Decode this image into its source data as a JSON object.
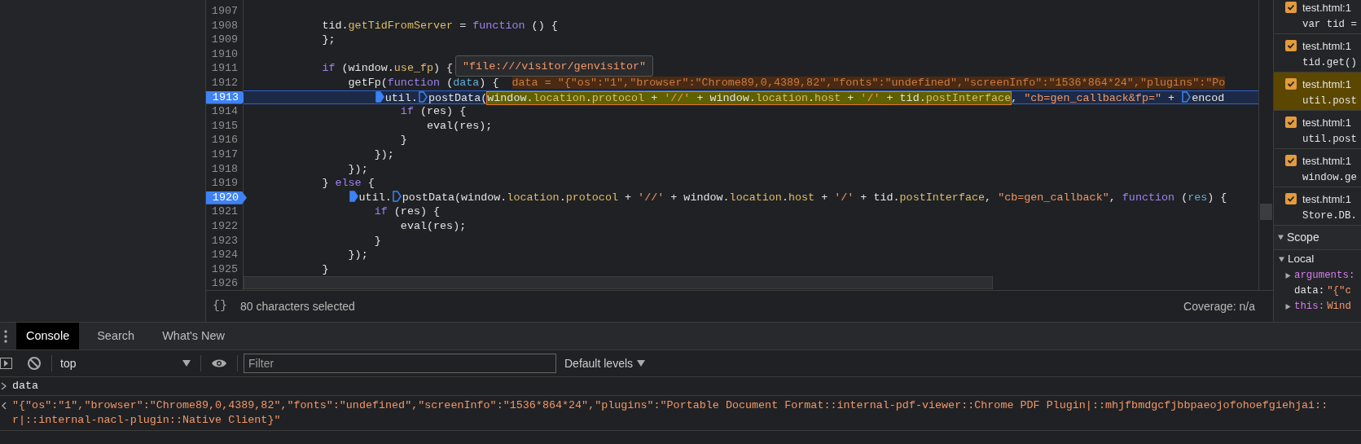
{
  "editor": {
    "tooltip": "\"file:///visitor/genvisitor\"",
    "lines": [
      {
        "number": "1907",
        "breakpoint": false,
        "paused": false
      },
      {
        "number": "1908",
        "breakpoint": false,
        "paused": false,
        "tokens": [
          {
            "kind": "plain",
            "text": "            tid."
          },
          {
            "kind": "prop",
            "text": "getTidFromServer"
          },
          {
            "kind": "plain",
            "text": " = "
          },
          {
            "kind": "keyword",
            "text": "function"
          },
          {
            "kind": "plain",
            "text": " () {"
          }
        ]
      },
      {
        "number": "1909",
        "breakpoint": false,
        "paused": false,
        "tokens": [
          {
            "kind": "plain",
            "text": "            };"
          }
        ]
      },
      {
        "number": "1910",
        "breakpoint": false,
        "paused": false
      },
      {
        "number": "1911",
        "breakpoint": false,
        "paused": false,
        "tokens": [
          {
            "kind": "keyword",
            "text": "            if"
          },
          {
            "kind": "plain",
            "text": " (window."
          },
          {
            "kind": "prop",
            "text": "use_fp"
          },
          {
            "kind": "plain",
            "text": ") {"
          }
        ]
      },
      {
        "number": "1912",
        "breakpoint": false,
        "paused": false,
        "tokens": [
          {
            "kind": "plain",
            "text": "                getFp("
          },
          {
            "kind": "keyword",
            "text": "function"
          },
          {
            "kind": "plain",
            "text": " ("
          },
          {
            "kind": "param",
            "text": "data"
          },
          {
            "kind": "plain",
            "text": ") {  "
          },
          {
            "kind": "inline",
            "text": "data = \"{\"os\":\"1\",\"browser\":\"Chrome89,0,4389,82\",\"fonts\":\"undefined\",\"screenInfo\":\"1536*864*24\",\"plugins\":\"Po"
          }
        ]
      },
      {
        "number": "1913",
        "breakpoint": true,
        "paused": true,
        "tokens": [
          {
            "kind": "marker_active",
            "text": "                    util."
          },
          {
            "kind": "marker",
            "text": "postData("
          },
          {
            "kind": "selection",
            "tokens": [
              {
                "kind": "plain",
                "text": "window."
              },
              {
                "kind": "prop",
                "text": "location"
              },
              {
                "kind": "plain",
                "text": "."
              },
              {
                "kind": "prop",
                "text": "protocol"
              },
              {
                "kind": "plain",
                "text": " + "
              },
              {
                "kind": "string",
                "text": "'//'"
              },
              {
                "kind": "plain",
                "text": " + window."
              },
              {
                "kind": "prop",
                "text": "location"
              },
              {
                "kind": "plain",
                "text": "."
              },
              {
                "kind": "prop",
                "text": "host"
              },
              {
                "kind": "plain",
                "text": " + "
              },
              {
                "kind": "string",
                "text": "'/'"
              },
              {
                "kind": "plain",
                "text": " + tid."
              },
              {
                "kind": "prop",
                "text": "postInterface"
              }
            ]
          },
          {
            "kind": "plain",
            "text": ", "
          },
          {
            "kind": "string",
            "text": "\"cb=gen_callback&fp=\""
          },
          {
            "kind": "plain",
            "text": " + "
          },
          {
            "kind": "marker",
            "text": "encod"
          }
        ]
      },
      {
        "number": "1914",
        "breakpoint": false,
        "paused": false,
        "tokens": [
          {
            "kind": "keyword",
            "text": "                        if"
          },
          {
            "kind": "plain",
            "text": " (res) {"
          }
        ]
      },
      {
        "number": "1915",
        "breakpoint": false,
        "paused": false,
        "tokens": [
          {
            "kind": "plain",
            "text": "                            eval(res);"
          }
        ]
      },
      {
        "number": "1916",
        "breakpoint": false,
        "paused": false,
        "tokens": [
          {
            "kind": "plain",
            "text": "                        }"
          }
        ]
      },
      {
        "number": "1917",
        "breakpoint": false,
        "paused": false,
        "tokens": [
          {
            "kind": "plain",
            "text": "                    });"
          }
        ]
      },
      {
        "number": "1918",
        "breakpoint": false,
        "paused": false,
        "tokens": [
          {
            "kind": "plain",
            "text": "                });"
          }
        ]
      },
      {
        "number": "1919",
        "breakpoint": false,
        "paused": false,
        "tokens": [
          {
            "kind": "plain",
            "text": "            } "
          },
          {
            "kind": "keyword",
            "text": "else"
          },
          {
            "kind": "plain",
            "text": " {"
          }
        ]
      },
      {
        "number": "1920",
        "breakpoint": true,
        "paused": false,
        "tokens": [
          {
            "kind": "marker_active",
            "text": "                util."
          },
          {
            "kind": "marker",
            "text": "postData(window."
          },
          {
            "kind": "prop",
            "text": "location"
          },
          {
            "kind": "plain",
            "text": "."
          },
          {
            "kind": "prop",
            "text": "protocol"
          },
          {
            "kind": "plain",
            "text": " + "
          },
          {
            "kind": "string",
            "text": "'//'"
          },
          {
            "kind": "plain",
            "text": " + window."
          },
          {
            "kind": "prop",
            "text": "location"
          },
          {
            "kind": "plain",
            "text": "."
          },
          {
            "kind": "prop",
            "text": "host"
          },
          {
            "kind": "plain",
            "text": " + "
          },
          {
            "kind": "string",
            "text": "'/'"
          },
          {
            "kind": "plain",
            "text": " + tid."
          },
          {
            "kind": "prop",
            "text": "postInterface"
          },
          {
            "kind": "plain",
            "text": ", "
          },
          {
            "kind": "string",
            "text": "\"cb=gen_callback\""
          },
          {
            "kind": "plain",
            "text": ", "
          },
          {
            "kind": "keyword",
            "text": "function"
          },
          {
            "kind": "plain",
            "text": " ("
          },
          {
            "kind": "param",
            "text": "res"
          },
          {
            "kind": "plain",
            "text": ") {"
          }
        ]
      },
      {
        "number": "1921",
        "breakpoint": false,
        "paused": false,
        "tokens": [
          {
            "kind": "keyword",
            "text": "                    if"
          },
          {
            "kind": "plain",
            "text": " (res) {"
          }
        ]
      },
      {
        "number": "1922",
        "breakpoint": false,
        "paused": false,
        "tokens": [
          {
            "kind": "plain",
            "text": "                        eval(res);"
          }
        ]
      },
      {
        "number": "1923",
        "breakpoint": false,
        "paused": false,
        "tokens": [
          {
            "kind": "plain",
            "text": "                    }"
          }
        ]
      },
      {
        "number": "1924",
        "breakpoint": false,
        "paused": false,
        "tokens": [
          {
            "kind": "plain",
            "text": "                });"
          }
        ]
      },
      {
        "number": "1925",
        "breakpoint": false,
        "paused": false,
        "tokens": [
          {
            "kind": "plain",
            "text": "            }"
          }
        ]
      },
      {
        "number": "1926",
        "breakpoint": false,
        "paused": false
      }
    ]
  },
  "status_bar": {
    "format_button": "{}",
    "selection": "80 characters selected",
    "coverage": "Coverage: n/a"
  },
  "breakpoints": [
    {
      "file": "test.html:1",
      "code": "var tid =",
      "checked": true,
      "selected": false
    },
    {
      "file": "test.html:1",
      "code": "tid.get()",
      "checked": true,
      "selected": false
    },
    {
      "file": "test.html:1",
      "code": "util.post",
      "checked": true,
      "selected": true
    },
    {
      "file": "test.html:1",
      "code": "util.post",
      "checked": true,
      "selected": false
    },
    {
      "file": "test.html:1",
      "code": "window.ge",
      "checked": true,
      "selected": false
    },
    {
      "file": "test.html:1",
      "code": "Store.DB.",
      "checked": true,
      "selected": false
    }
  ],
  "scope": {
    "title": "Scope",
    "expanded": true,
    "groups": [
      {
        "title": "Local",
        "expanded": true,
        "children": [
          {
            "name": "arguments:",
            "expandable": true
          },
          {
            "name": "data:",
            "value": "\"{\"c",
            "expandable": false
          },
          {
            "name": "this:",
            "value": "Wind",
            "expandable": true
          }
        ]
      }
    ]
  },
  "drawer": {
    "tabs": [
      {
        "label": "Console",
        "selected": true
      },
      {
        "label": "Search",
        "selected": false
      },
      {
        "label": "What's New",
        "selected": false
      }
    ],
    "context": "top",
    "filter_placeholder": "Filter",
    "levels": "Default levels",
    "console": [
      {
        "kind": "input",
        "lines": [
          "data"
        ]
      },
      {
        "kind": "output",
        "lines": [
          "\"{\"os\":\"1\",\"browser\":\"Chrome89,0,4389,82\",\"fonts\":\"undefined\",\"screenInfo\":\"1536*864*24\",\"plugins\":\"Portable Document Format::internal-pdf-viewer::Chrome PDF Plugin|::mhjfbmdgcfjbbpaeojofohoefgiehjai::",
          "r|::internal-nacl-plugin::Native Client}\""
        ]
      }
    ]
  }
}
